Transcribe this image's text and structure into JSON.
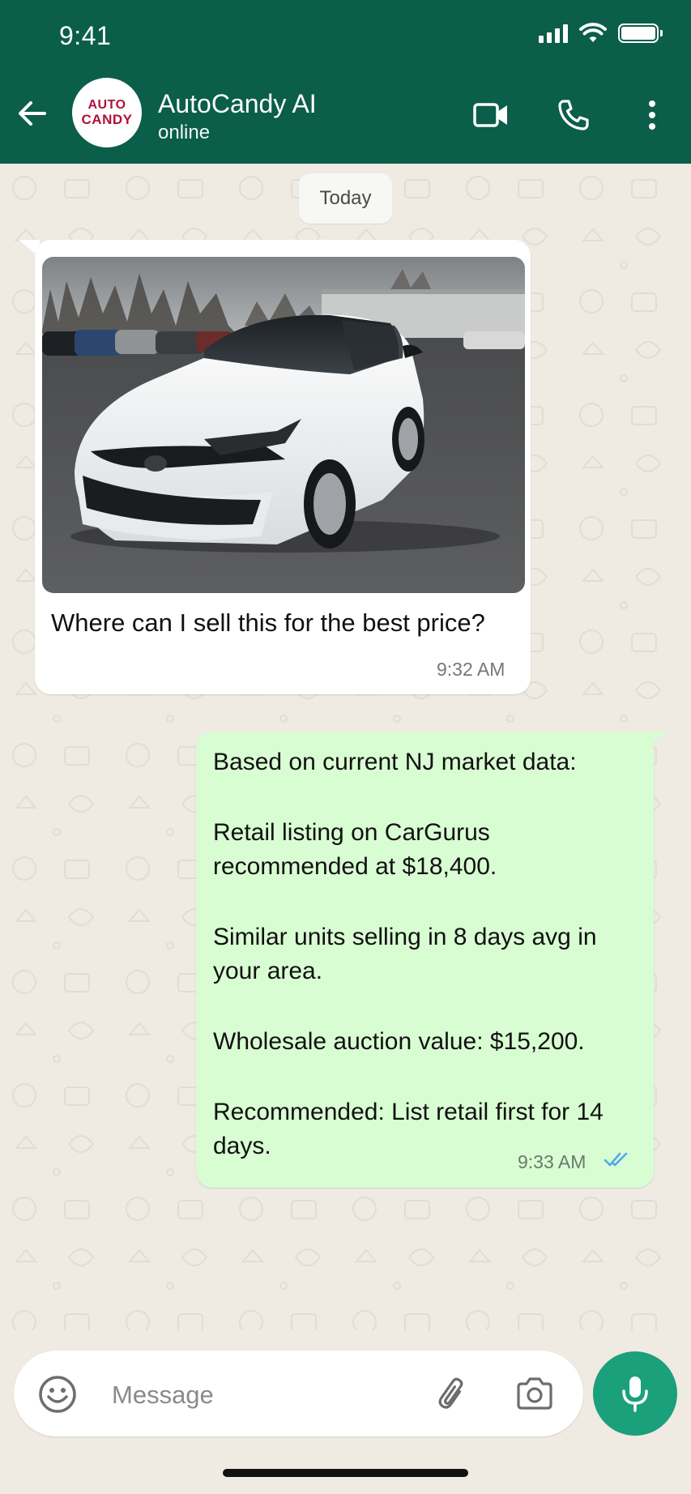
{
  "status_bar": {
    "time": "9:41"
  },
  "header": {
    "contact_name": "AutoCandy AI",
    "contact_status": "online",
    "avatar_line1": "AUTO",
    "avatar_line2": "CANDY",
    "icons": [
      "back-arrow-icon",
      "video-call-icon",
      "phone-icon",
      "more-vertical-icon"
    ],
    "background_color": "#0b5e49"
  },
  "chat": {
    "date_chip": "Today",
    "messages": [
      {
        "direction": "incoming",
        "has_photo": true,
        "photo_subject": "white sedan in parking lot",
        "text": "Where can I sell this for the best price?",
        "time": "9:32 AM"
      },
      {
        "direction": "outgoing",
        "paragraphs": [
          "Based on current NJ market data:",
          "Retail listing on CarGurus recommended at $18,400.",
          "Similar units selling in 8 days avg in your area.",
          "Wholesale auction value: $15,200.",
          "Recommended: List retail first for 14 days."
        ],
        "time": "9:33 AM",
        "read_status": "read"
      }
    ],
    "outgoing_bubble_color": "#d9fdd3"
  },
  "input_bar": {
    "placeholder": "Message",
    "icons": [
      "emoji-icon",
      "attachment-icon",
      "camera-icon",
      "microphone-icon"
    ],
    "mic_color": "#1aa07a"
  }
}
